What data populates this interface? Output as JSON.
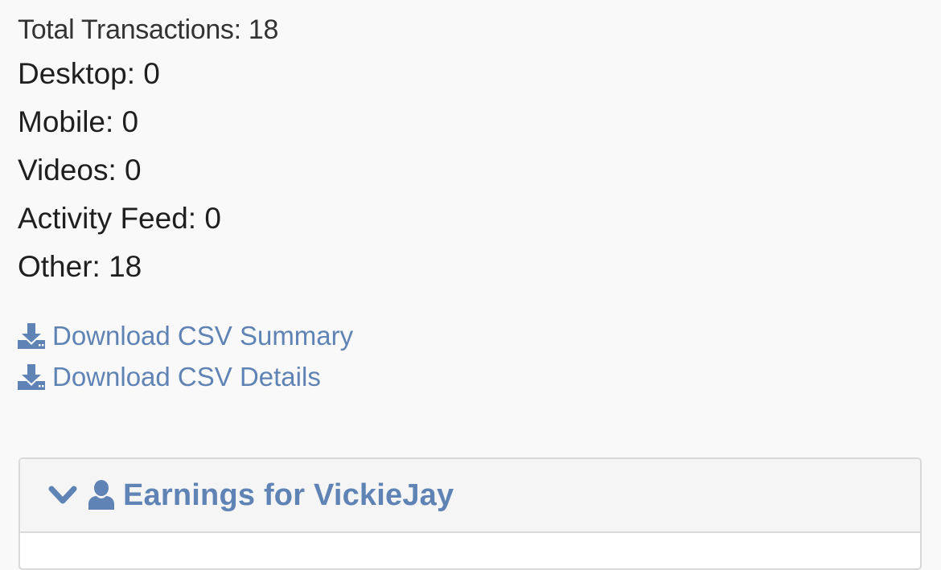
{
  "stats": {
    "total": "Total Transactions: 18",
    "desktop": "Desktop: 0",
    "mobile": "Mobile: 0",
    "videos": "Videos: 0",
    "activity_feed": "Activity Feed: 0",
    "other": "Other: 18"
  },
  "downloads": {
    "summary_label": "Download CSV Summary",
    "details_label": "Download CSV Details",
    "icon": "download-icon"
  },
  "panel": {
    "title": "Earnings for VickieJay",
    "toggle_icon": "chevron-down-icon",
    "user_icon": "user-icon"
  },
  "colors": {
    "link": "#5f83b4",
    "background": "#f9f9f9",
    "panel_border": "#d9d9d9"
  }
}
